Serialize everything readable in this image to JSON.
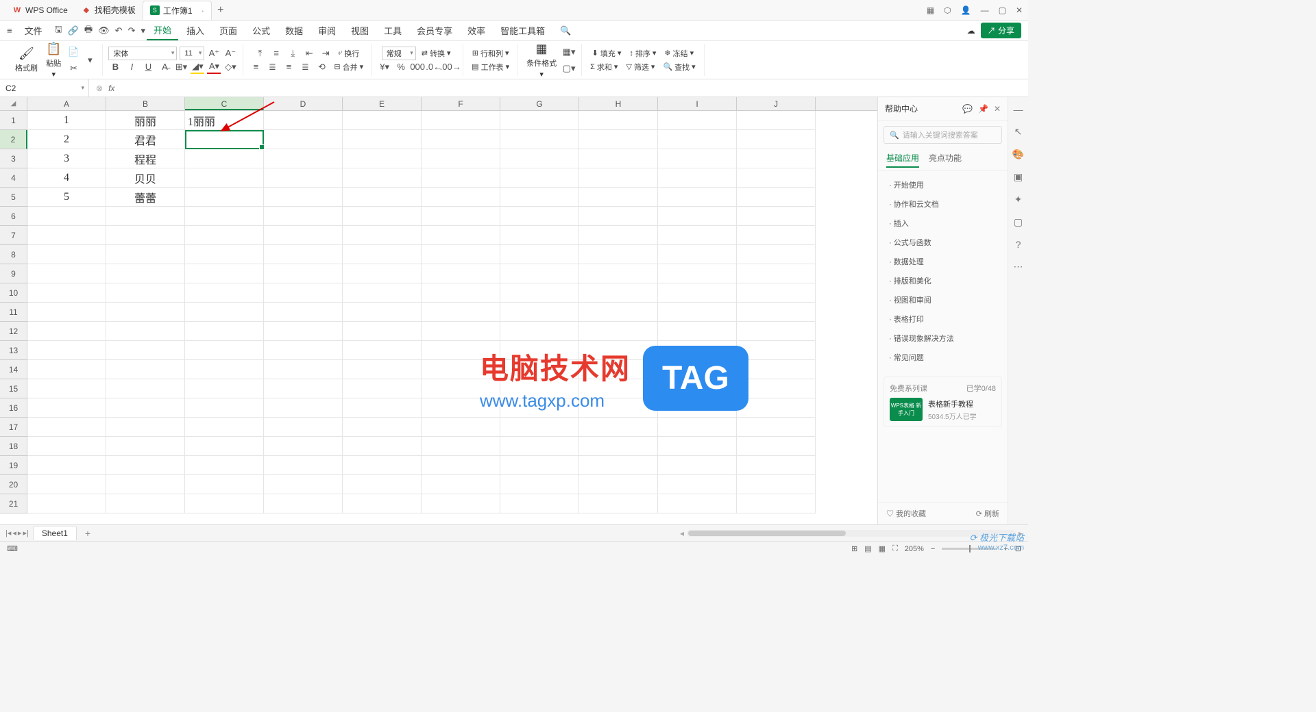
{
  "titlebar": {
    "tabs": [
      {
        "icon": "W",
        "label": "WPS Office"
      },
      {
        "icon": "D",
        "label": "找稻壳模板"
      },
      {
        "icon": "S",
        "label": "工作簿1"
      }
    ]
  },
  "menubar": {
    "file": "文件",
    "items": [
      "开始",
      "插入",
      "页面",
      "公式",
      "数据",
      "审阅",
      "视图",
      "工具",
      "会员专享",
      "效率",
      "智能工具箱"
    ],
    "active": "开始",
    "share": "分享"
  },
  "ribbon": {
    "format_brush": "格式刷",
    "paste": "粘贴",
    "font_name": "宋体",
    "font_size": "11",
    "wrap": "换行",
    "merge": "合并",
    "number_format": "常规",
    "convert": "转换",
    "row_col": "行和列",
    "worksheet": "工作表",
    "cond_format": "条件格式",
    "fill": "填充",
    "sort": "排序",
    "freeze": "冻结",
    "sum": "求和",
    "filter": "筛选",
    "find": "查找"
  },
  "formula_bar": {
    "name_box": "C2",
    "fx": "fx"
  },
  "columns": [
    "A",
    "B",
    "C",
    "D",
    "E",
    "F",
    "G",
    "H",
    "I",
    "J"
  ],
  "rows_count": 21,
  "selected_cell": {
    "row": 2,
    "col": "C"
  },
  "cell_data": {
    "A1": "1",
    "B1": "丽丽",
    "C1": "1丽丽",
    "A2": "2",
    "B2": "君君",
    "A3": "3",
    "B3": "程程",
    "A4": "4",
    "B4": "贝贝",
    "A5": "5",
    "B5": "蕾蕾"
  },
  "help_panel": {
    "title": "帮助中心",
    "search_placeholder": "请输入关键词搜索答案",
    "tabs": [
      "基础应用",
      "亮点功能"
    ],
    "items": [
      "开始使用",
      "协作和云文档",
      "插入",
      "公式与函数",
      "数据处理",
      "排版和美化",
      "视图和审阅",
      "表格打印",
      "错误现象解决方法",
      "常见问题"
    ],
    "course_section": "免费系列课",
    "course_progress": "已学0/48",
    "course_thumb": "WPS表格\n新手入门",
    "course_title": "表格新手教程",
    "course_sub": "5034.5万人已学",
    "favorites": "我的收藏",
    "refresh": "刷新"
  },
  "sheet_tabs": {
    "sheet_name": "Sheet1"
  },
  "statusbar": {
    "zoom": "205%"
  },
  "watermark": {
    "line1": "电脑技术网",
    "line2": "www.tagxp.com",
    "tag": "TAG",
    "site": "极光下载站",
    "url": "www.xz7.com"
  }
}
